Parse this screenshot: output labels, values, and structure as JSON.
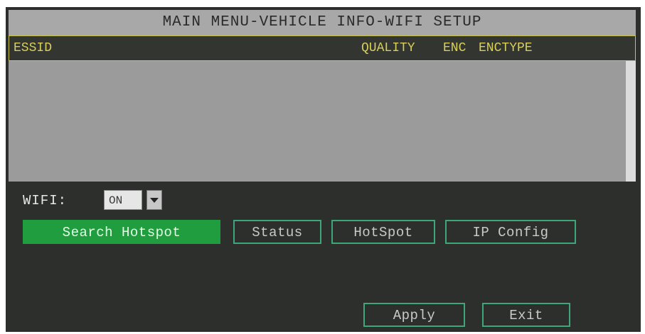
{
  "title": "MAIN MENU-VEHICLE INFO-WIFI SETUP",
  "hotspot_list": {
    "columns": {
      "essid": "ESSID",
      "quality": "QUALITY",
      "enc": "ENC",
      "enctype": "ENCTYPE"
    },
    "rows": []
  },
  "wifi": {
    "label": "WIFI:",
    "value": "ON"
  },
  "buttons": {
    "search_hotspot": "Search Hotspot",
    "status": "Status",
    "hotspot": "HotSpot",
    "ip_config": "IP Config",
    "apply": "Apply",
    "exit": "Exit"
  },
  "colors": {
    "background": "#2d2f2d",
    "title_bar": "#a8a8a8",
    "header_text": "#d8cf5a",
    "selected_button": "#1f9d3f",
    "button_border": "#3fa67a"
  }
}
